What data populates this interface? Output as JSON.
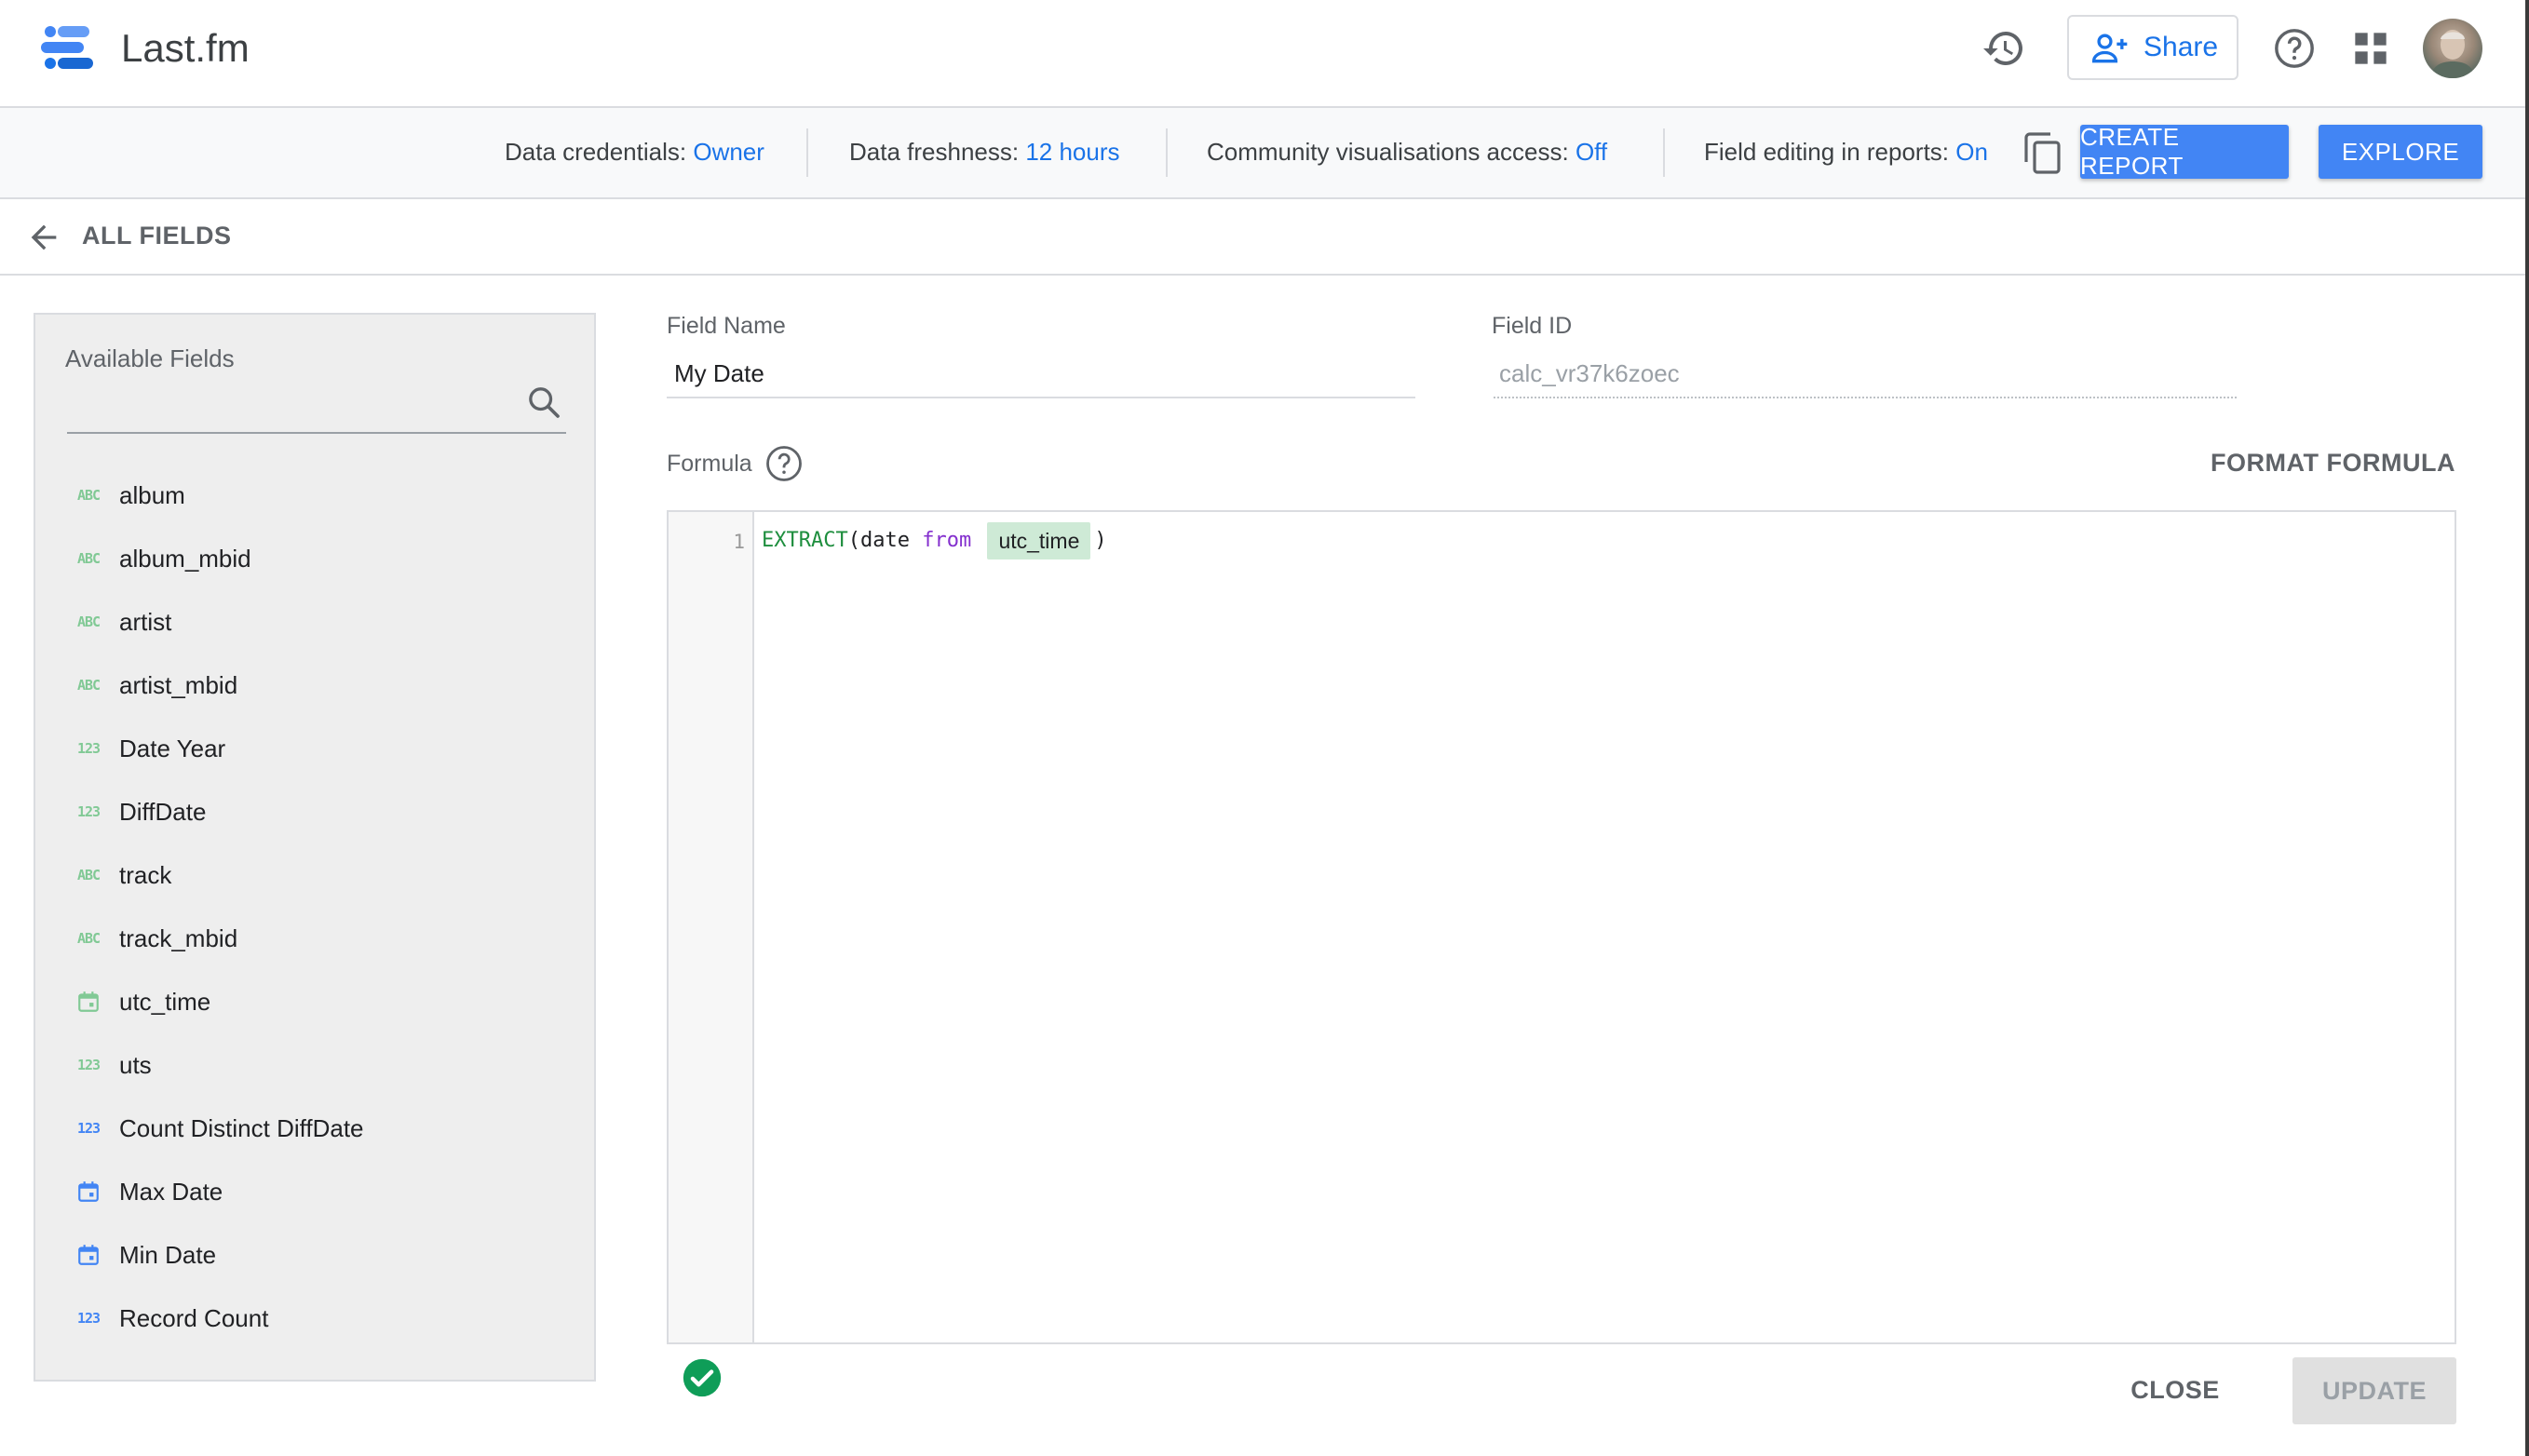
{
  "header": {
    "app_title": "Last.fm",
    "share_label": "Share",
    "icons": [
      "history-icon",
      "add-person-icon",
      "help-icon",
      "apps-grid-icon"
    ]
  },
  "infobar": {
    "credentials_label": "Data credentials:",
    "credentials_value": "Owner",
    "freshness_label": "Data freshness:",
    "freshness_value": "12 hours",
    "community_label": "Community visualisations access:",
    "community_value": "Off",
    "editing_label": "Field editing in reports:",
    "editing_value": "On",
    "create_report_label": "CREATE REPORT",
    "explore_label": "EXPLORE"
  },
  "nav": {
    "back_label": "ALL FIELDS"
  },
  "fields_panel": {
    "title": "Available Fields",
    "items": [
      {
        "type": "text",
        "type_glyph": "ABC",
        "name": "album"
      },
      {
        "type": "text",
        "type_glyph": "ABC",
        "name": "album_mbid"
      },
      {
        "type": "text",
        "type_glyph": "ABC",
        "name": "artist"
      },
      {
        "type": "text",
        "type_glyph": "ABC",
        "name": "artist_mbid"
      },
      {
        "type": "number",
        "type_glyph": "123",
        "name": "Date Year"
      },
      {
        "type": "number",
        "type_glyph": "123",
        "name": "DiffDate"
      },
      {
        "type": "text",
        "type_glyph": "ABC",
        "name": "track"
      },
      {
        "type": "text",
        "type_glyph": "ABC",
        "name": "track_mbid"
      },
      {
        "type": "date",
        "type_glyph": "calendar",
        "name": "utc_time"
      },
      {
        "type": "number",
        "type_glyph": "123",
        "name": "uts"
      },
      {
        "type": "metric-number",
        "type_glyph": "123",
        "name": "Count Distinct DiffDate"
      },
      {
        "type": "metric-date",
        "type_glyph": "calendar",
        "name": "Max Date"
      },
      {
        "type": "metric-date",
        "type_glyph": "calendar",
        "name": "Min Date"
      },
      {
        "type": "metric-number",
        "type_glyph": "123",
        "name": "Record Count"
      }
    ]
  },
  "form": {
    "field_name_label": "Field Name",
    "field_name_value": "My Date",
    "field_id_label": "Field ID",
    "field_id_value": "calc_vr37k6zoec",
    "formula_label": "Formula",
    "format_formula_label": "FORMAT FORMULA",
    "line_number": "1",
    "formula": {
      "fn": "EXTRACT",
      "open": "(date ",
      "kw": "from",
      "field": "utc_time",
      "close": ")"
    },
    "close_label": "CLOSE",
    "update_label": "UPDATE"
  },
  "colors": {
    "accent_blue": "#1a73e8",
    "button_blue": "#4285f4",
    "dimension_green": "#81c995",
    "valid_green": "#0f9d58"
  }
}
